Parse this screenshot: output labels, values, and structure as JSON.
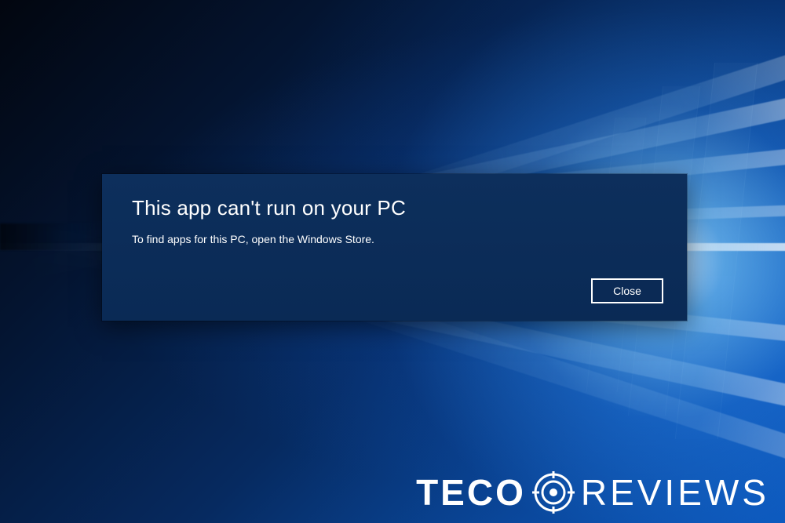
{
  "dialog": {
    "title": "This app can't run on your PC",
    "message": "To find apps for this PC, open the Windows Store.",
    "close_label": "Close"
  },
  "watermark": {
    "brand_bold": "TECO",
    "brand_light": "REVIEWS"
  }
}
